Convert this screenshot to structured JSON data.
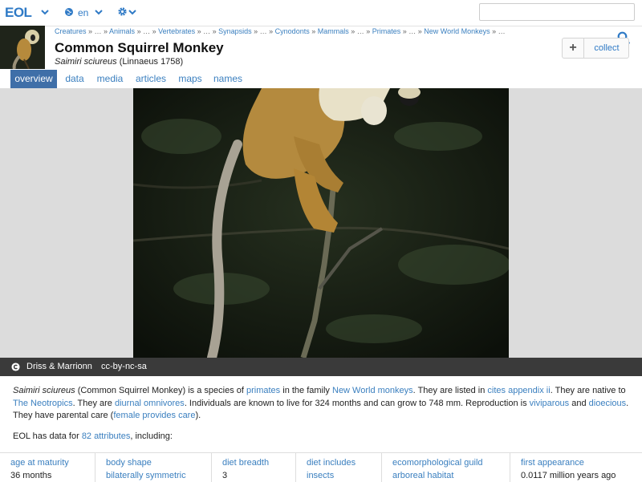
{
  "header": {
    "logo": "EOL",
    "language": "en",
    "search": {
      "value": "",
      "placeholder": ""
    }
  },
  "breadcrumb": {
    "items": [
      {
        "label": "Creatures",
        "link": true
      },
      {
        "label": " » … » ",
        "link": false
      },
      {
        "label": "Animals",
        "link": true
      },
      {
        "label": " » … » ",
        "link": false
      },
      {
        "label": "Vertebrates",
        "link": true
      },
      {
        "label": " » … » ",
        "link": false
      },
      {
        "label": "Synapsids",
        "link": true
      },
      {
        "label": " » … » ",
        "link": false
      },
      {
        "label": "Cynodonts",
        "link": true
      },
      {
        "label": " » ",
        "link": false
      },
      {
        "label": "Mammals",
        "link": true
      },
      {
        "label": " » … » ",
        "link": false
      },
      {
        "label": "Primates",
        "link": true
      },
      {
        "label": " » … » ",
        "link": false
      },
      {
        "label": "New World Monkeys",
        "link": true
      },
      {
        "label": " » …",
        "link": false
      }
    ]
  },
  "page": {
    "title": "Common Squirrel Monkey",
    "sci_name": "Saimiri sciureus",
    "authority": " (Linnaeus 1758)"
  },
  "collect": {
    "plus": "+",
    "label": "collect"
  },
  "tabs": [
    {
      "label": "overview",
      "active": true
    },
    {
      "label": "data",
      "active": false
    },
    {
      "label": "media",
      "active": false
    },
    {
      "label": "articles",
      "active": false
    },
    {
      "label": "maps",
      "active": false
    },
    {
      "label": "names",
      "active": false
    }
  ],
  "media": {
    "credit": "Driss & Marrionn",
    "license": "cc-by-nc-sa"
  },
  "description": {
    "sentence_1": {
      "sci": "Saimiri sciureus",
      "t1": " (Common Squirrel Monkey) is a species of ",
      "l1": "primates",
      "t2": " in the family ",
      "l2": "New World monkeys",
      "t3": ". They are listed in ",
      "l3": "cites appendix ii",
      "t4": ". They are native to ",
      "l4": "The Neotropics",
      "t5": ". They are ",
      "l5": "diurnal omnivores",
      "t6": ". Individuals are known to live for 324 months and can grow to 748 mm. Reproduction is ",
      "l6": "viviparous",
      "t7": " and ",
      "l7": "dioecious",
      "t8": ". They have parental care (",
      "l8": "female provides care",
      "t9": ")."
    }
  },
  "data_lead": {
    "prefix": "EOL has data for ",
    "link": "82 attributes",
    "suffix": ", including:"
  },
  "attributes": [
    {
      "name": "age at maturity",
      "value": "36 months",
      "link": false
    },
    {
      "name": "body shape",
      "value": "bilaterally symmetric",
      "link": true
    },
    {
      "name": "diet breadth",
      "value": "3",
      "link": false
    },
    {
      "name": "diet includes",
      "value": "insects",
      "link": true
    },
    {
      "name": "ecomorphological guild",
      "value": "arboreal habitat",
      "link": true
    },
    {
      "name": "first appearance",
      "value": "0.0117 million years ago",
      "link": false
    }
  ],
  "colors": {
    "accent": "#3a7fbf",
    "tab_active": "#3f6fa8",
    "caption_bar": "#3a3a3a"
  }
}
